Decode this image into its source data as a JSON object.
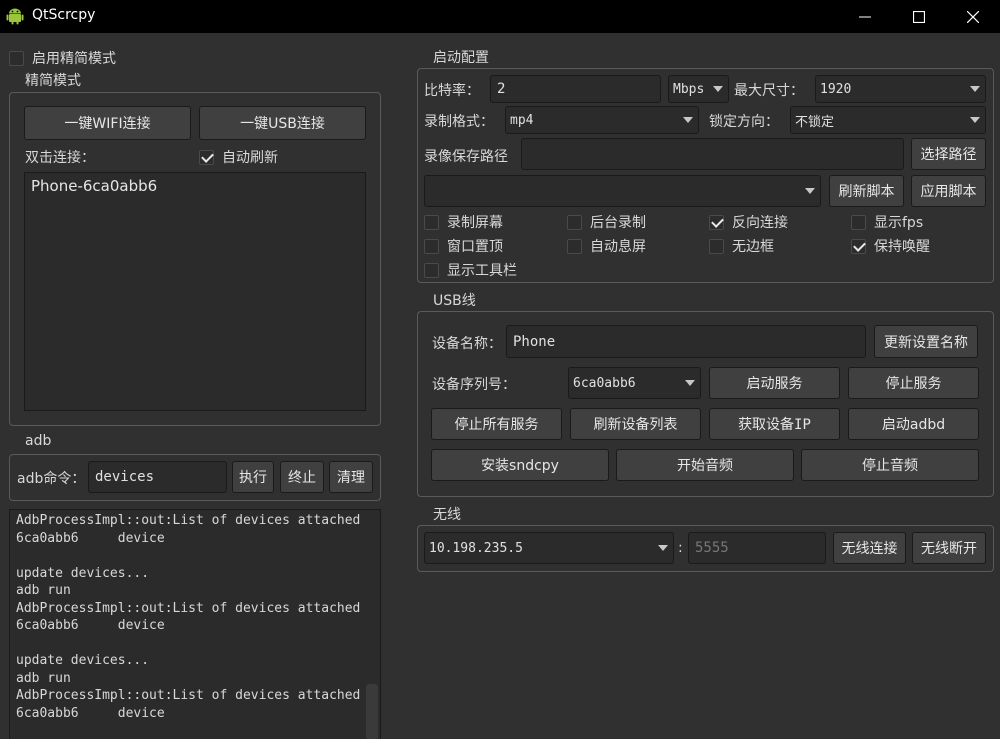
{
  "window": {
    "title": "QtScrcpy",
    "icon": "android-icon"
  },
  "left": {
    "simple_mode_toggle": {
      "label": "启用精简模式",
      "checked": false
    },
    "simple_group": {
      "title": "精简模式",
      "wifi_button": "一键WIFI连接",
      "usb_button": "一键USB连接",
      "double_click_label": "双击连接：",
      "auto_refresh": {
        "label": "自动刷新",
        "checked": true
      },
      "devices": [
        "Phone-6ca0abb6"
      ]
    },
    "adb_group": {
      "title": "adb",
      "command_label": "adb命令：",
      "command_value": "devices",
      "execute_button": "执行",
      "stop_button": "终止",
      "clear_button": "清理"
    },
    "log_lines": [
      "AdbProcessImpl::out:List of devices attached",
      "6ca0abb6     device",
      "",
      "update devices...",
      "adb run",
      "AdbProcessImpl::out:List of devices attached",
      "6ca0abb6     device",
      "",
      "update devices...",
      "adb run",
      "AdbProcessImpl::out:List of devices attached",
      "6ca0abb6     device"
    ]
  },
  "launch_config": {
    "title": "启动配置",
    "bitrate_label": "比特率：",
    "bitrate_value": "2",
    "bitrate_unit": "Mbps",
    "max_size_label": "最大尺寸：",
    "max_size_value": "1920",
    "record_format_label": "录制格式：",
    "record_format_value": "mp4",
    "lock_orientation_label": "锁定方向：",
    "lock_orientation_value": "不锁定",
    "record_path_label": "录像保存路径",
    "record_path_value": "",
    "select_path_button": "选择路径",
    "script_value": "",
    "refresh_script_button": "刷新脚本",
    "apply_script_button": "应用脚本",
    "options": [
      {
        "label": "录制屏幕",
        "checked": false
      },
      {
        "label": "后台录制",
        "checked": false
      },
      {
        "label": "反向连接",
        "checked": true
      },
      {
        "label": "显示fps",
        "checked": false
      },
      {
        "label": "窗口置顶",
        "checked": false
      },
      {
        "label": "自动息屏",
        "checked": false
      },
      {
        "label": "无边框",
        "checked": false
      },
      {
        "label": "保持唤醒",
        "checked": true
      },
      {
        "label": "显示工具栏",
        "checked": false
      }
    ]
  },
  "usb": {
    "title": "USB线",
    "device_name_label": "设备名称：",
    "device_name_value": "Phone",
    "update_name_button": "更新设置名称",
    "serial_label": "设备序列号：",
    "serial_value": "6ca0abb6",
    "start_service_button": "启动服务",
    "stop_service_button": "停止服务",
    "stop_all_button": "停止所有服务",
    "refresh_devices_button": "刷新设备列表",
    "get_ip_button": "获取设备IP",
    "start_adbd_button": "启动adbd",
    "install_sndcpy_button": "安装sndcpy",
    "start_audio_button": "开始音频",
    "stop_audio_button": "停止音频"
  },
  "wireless": {
    "title": "无线",
    "ip_value": "10.198.235.5",
    "separator": ":",
    "port_placeholder": "5555",
    "connect_button": "无线连接",
    "disconnect_button": "无线断开"
  }
}
